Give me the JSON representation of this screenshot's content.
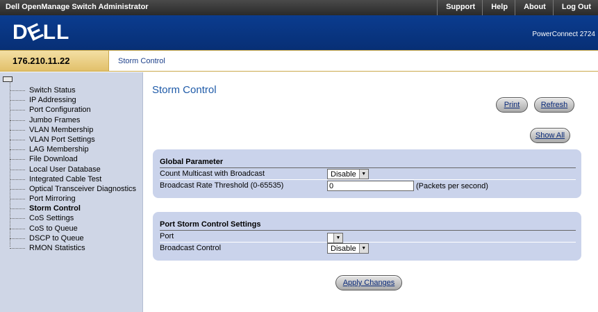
{
  "topbar": {
    "title": "Dell OpenManage Switch Administrator",
    "menu": [
      "Support",
      "Help",
      "About",
      "Log Out"
    ]
  },
  "banner": {
    "logo": "DELL",
    "model": "PowerConnect 2724"
  },
  "crumbbar": {
    "ip": "176.210.11.22",
    "crumb": "Storm Control"
  },
  "sidebar": {
    "items": [
      "Switch Status",
      "IP Addressing",
      "Port Configuration",
      "Jumbo Frames",
      "VLAN Membership",
      "VLAN Port Settings",
      "LAG Membership",
      "File Download",
      "Local User Database",
      "Integrated Cable Test",
      "Optical Transceiver Diagnostics",
      "Port Mirroring",
      "Storm Control",
      "CoS Settings",
      "CoS to Queue",
      "DSCP to Queue",
      "RMON Statistics"
    ],
    "active_index": 12
  },
  "content": {
    "title": "Storm Control",
    "print_label": "Print",
    "refresh_label": "Refresh",
    "showall_label": "Show All",
    "apply_label": "Apply Changes",
    "global": {
      "title": "Global Parameter",
      "count_multicast_label": "Count Multicast with Broadcast",
      "count_multicast_value": "Disable",
      "threshold_label": "Broadcast Rate Threshold (0-65535)",
      "threshold_value": "0",
      "threshold_unit": "(Packets per second)"
    },
    "port_settings": {
      "title": "Port Storm Control Settings",
      "port_label": "Port",
      "port_value": "",
      "broadcast_label": "Broadcast Control",
      "broadcast_value": "Disable"
    }
  }
}
